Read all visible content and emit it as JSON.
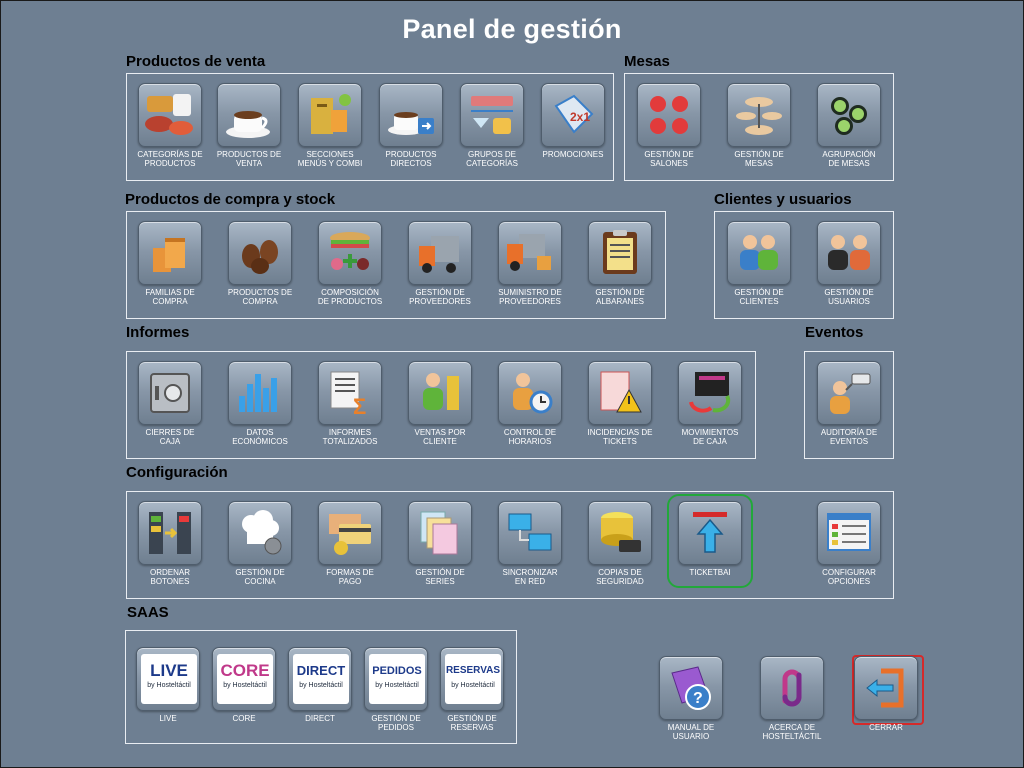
{
  "page": {
    "title": "Panel de gestión"
  },
  "sections": {
    "productos_venta": "Productos de venta",
    "mesas": "Mesas",
    "compra_stock": "Productos de compra y stock",
    "clientes": "Clientes y usuarios",
    "informes": "Informes",
    "eventos": "Eventos",
    "configuracion": "Configuración",
    "saas": "SAAS"
  },
  "productos_venta": [
    {
      "label": "CATEGORÍAS DE PRODUCTOS",
      "icon": "food-categories-icon"
    },
    {
      "label": "PRODUCTOS DE VENTA",
      "icon": "coffee-cup-icon"
    },
    {
      "label": "SECCIONES MENÚS Y COMBI",
      "icon": "menu-card-icon"
    },
    {
      "label": "PRODUCTOS DIRECTOS",
      "icon": "coffee-direct-icon"
    },
    {
      "label": "GRUPOS DE CATEGORÍAS",
      "icon": "category-groups-icon"
    },
    {
      "label": "PROMOCIONES",
      "icon": "promotion-tag-icon"
    }
  ],
  "mesas": [
    {
      "label": "GESTIÓN DE SALONES",
      "icon": "salon-tables-icon"
    },
    {
      "label": "GESTIÓN DE MESAS",
      "icon": "tables-icon"
    },
    {
      "label": "AGRUPACIÓN DE MESAS",
      "icon": "table-group-icon"
    }
  ],
  "compra_stock": [
    {
      "label": "FAMILIAS DE COMPRA",
      "icon": "boxes-icon"
    },
    {
      "label": "PRODUCTOS DE COMPRA",
      "icon": "coffee-beans-icon"
    },
    {
      "label": "COMPOSICIÓN DE PRODUCTOS",
      "icon": "sandwich-composition-icon"
    },
    {
      "label": "GESTIÓN DE PROVEEDORES",
      "icon": "truck-icon"
    },
    {
      "label": "SUMINISTRO DE PROVEEDORES",
      "icon": "supply-truck-icon"
    },
    {
      "label": "GESTIÓN DE ALBARANES",
      "icon": "clipboard-icon"
    }
  ],
  "clientes": [
    {
      "label": "GESTIÓN DE CLIENTES",
      "icon": "clients-icon"
    },
    {
      "label": "GESTIÓN DE USUARIOS",
      "icon": "users-icon"
    }
  ],
  "informes": [
    {
      "label": "CIERRES DE CAJA",
      "icon": "safe-icon"
    },
    {
      "label": "DATOS ECONÓMICOS",
      "icon": "bar-chart-icon"
    },
    {
      "label": "INFORMES TOTALIZADOS",
      "icon": "sum-report-icon"
    },
    {
      "label": "VENTAS POR CLIENTE",
      "icon": "client-sales-icon"
    },
    {
      "label": "CONTROL DE HORARIOS",
      "icon": "clock-person-icon"
    },
    {
      "label": "INCIDENCIAS DE TICKETS",
      "icon": "ticket-warning-icon"
    },
    {
      "label": "MOVIMIENTOS DE CAJA",
      "icon": "cash-drawer-icon"
    }
  ],
  "eventos": [
    {
      "label": "AUDITORÍA DE EVENTOS",
      "icon": "camera-audit-icon"
    }
  ],
  "configuracion": [
    {
      "label": "ORDENAR BOTONES",
      "icon": "sort-buttons-icon"
    },
    {
      "label": "GESTIÓN DE COCINA",
      "icon": "chef-hat-icon"
    },
    {
      "label": "FORMAS DE PAGO",
      "icon": "payment-icon"
    },
    {
      "label": "GESTIÓN DE SERIES",
      "icon": "series-documents-icon"
    },
    {
      "label": "SINCRONIZAR EN RED",
      "icon": "network-sync-icon"
    },
    {
      "label": "COPIAS DE SEGURIDAD",
      "icon": "backup-database-icon"
    },
    {
      "label": "TICKETBAI",
      "icon": "upload-arrow-icon"
    },
    {
      "label": "CONFIGURAR OPCIONES",
      "icon": "settings-window-icon"
    }
  ],
  "saas": [
    {
      "label": "LIVE",
      "logo": "LIVE",
      "color": "#1d3a8a"
    },
    {
      "label": "CORE",
      "logo": "CORE",
      "color": "#c0398a"
    },
    {
      "label": "DIRECT",
      "logo": "DIRECT",
      "color": "#1d3a8a"
    },
    {
      "label": "GESTIÓN DE PEDIDOS",
      "logo": "PEDIDOS",
      "color": "#1d3a8a"
    },
    {
      "label": "GESTIÓN DE RESERVAS",
      "logo": "RESERVAS",
      "color": "#1d3a8a"
    }
  ],
  "saas_sub": "by Hosteltáctil",
  "footer": [
    {
      "label": "MANUAL DE USUARIO",
      "icon": "help-book-icon"
    },
    {
      "label": "ACERCA DE HOSTELTÁCTIL",
      "icon": "hosteltactil-logo-icon"
    },
    {
      "label": "CERRAR",
      "icon": "exit-icon"
    }
  ],
  "colors": {
    "background": "#6e7f92",
    "selected_ring": "#22a83a",
    "close_ring": "#d52a2a"
  }
}
